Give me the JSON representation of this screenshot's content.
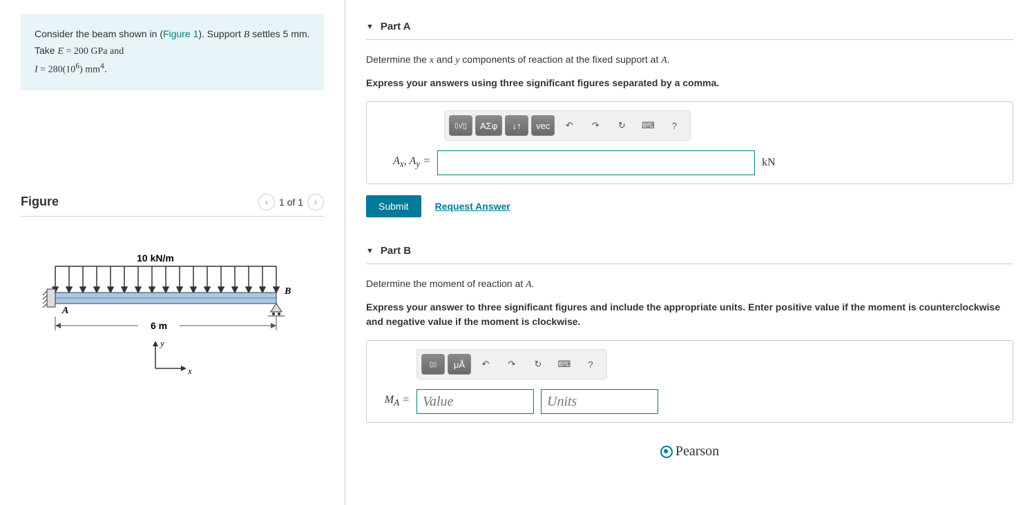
{
  "problem": {
    "text_pre": "Consider the beam shown in (",
    "figure_link": "Figure 1",
    "text_post": "). Support ",
    "support": "B",
    "settle_text": " settles 5 mm. Take ",
    "E_label": "E",
    "E_value": " = 200 GPa and",
    "I_label": "I",
    "I_value": " = 280(10",
    "I_exp": "6",
    "I_unit": ") mm",
    "I_exp2": "4",
    "period": "."
  },
  "figure": {
    "title": "Figure",
    "pager": "1 of 1",
    "load_label": "10 kN/m",
    "length_label": "6 m",
    "point_a": "A",
    "point_b": "B",
    "axis_y": "y",
    "axis_x": "x"
  },
  "partA": {
    "title": "Part A",
    "prompt_pre": "Determine the ",
    "var_x": "x",
    "prompt_mid": " and ",
    "var_y": "y",
    "prompt_post": " components of reaction at the fixed support at ",
    "point": "A",
    "period": ".",
    "instruction": "Express your answers using three significant figures separated by a comma.",
    "label": "A",
    "sub1": "x",
    "sep": ", ",
    "sub2": "y",
    "equals": " =",
    "unit": "kN",
    "submit": "Submit",
    "request": "Request Answer",
    "tools": {
      "templates": "▯√▯",
      "greek": "ΑΣφ",
      "updown": "↓↑",
      "vec": "vec",
      "undo": "↶",
      "redo": "↷",
      "reset": "↻",
      "keyboard": "⌨",
      "help": "?"
    }
  },
  "partB": {
    "title": "Part B",
    "prompt_pre": "Determine the moment of reaction at ",
    "point": "A",
    "period": ".",
    "instruction": "Express your answer to three significant figures and include the appropriate units. Enter positive value if the moment is counterclockwise and negative value if the moment is clockwise.",
    "label": "M",
    "sub": "A",
    "equals": " =",
    "value_placeholder": "Value",
    "units_placeholder": "Units",
    "tools": {
      "templates": "▯▯",
      "units": "μÅ",
      "undo": "↶",
      "redo": "↷",
      "reset": "↻",
      "keyboard": "⌨",
      "help": "?"
    }
  },
  "footer": {
    "brand": "Pearson"
  }
}
